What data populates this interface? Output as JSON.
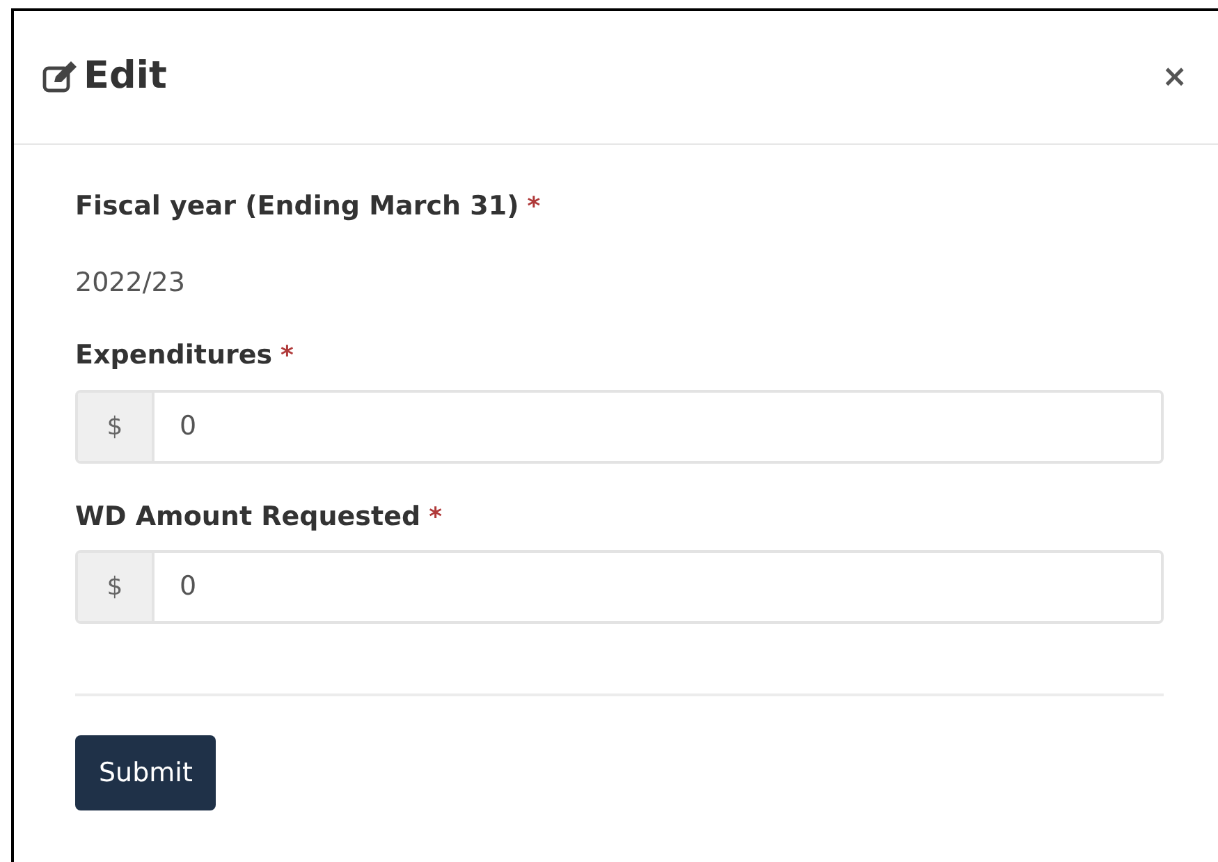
{
  "dialog": {
    "title": "Edit",
    "close": "×"
  },
  "fields": [
    {
      "kind": "static",
      "label": "Fiscal year (Ending March 31)",
      "required_mark": "*",
      "value": "2022/23"
    },
    {
      "kind": "currency",
      "label": "Expenditures",
      "required_mark": "*",
      "prefix": "$",
      "value": "0"
    },
    {
      "kind": "currency",
      "label": "WD Amount Requested",
      "required_mark": "*",
      "prefix": "$",
      "value": "0"
    }
  ],
  "submit": "Submit"
}
